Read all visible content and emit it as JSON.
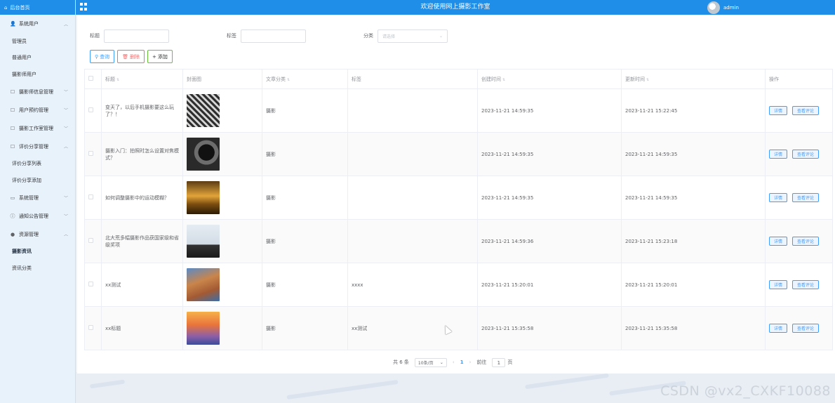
{
  "brand": {
    "label": "后台首页"
  },
  "header": {
    "title": "欢迎使用网上摄影工作室",
    "user": "admin"
  },
  "sidebar": {
    "groups": [
      {
        "label": "系统用户",
        "icon": "user-icon",
        "expanded": true,
        "items": [
          "管理员",
          "普通用户",
          "摄影师用户"
        ]
      },
      {
        "label": "摄影师信息管理",
        "icon": "doc-icon",
        "expanded": false,
        "items": []
      },
      {
        "label": "用户预约管理",
        "icon": "doc-icon",
        "expanded": false,
        "items": []
      },
      {
        "label": "摄影工作室管理",
        "icon": "doc-icon",
        "expanded": false,
        "items": []
      },
      {
        "label": "评价分享管理",
        "icon": "doc-icon",
        "expanded": true,
        "items": [
          "评价分享列表",
          "评价分享添加"
        ]
      },
      {
        "label": "系统管理",
        "icon": "monitor-icon",
        "expanded": false,
        "items": []
      },
      {
        "label": "通知公告管理",
        "icon": "info-icon",
        "expanded": false,
        "items": []
      },
      {
        "label": "资源管理",
        "icon": "shield-icon",
        "expanded": true,
        "items": [
          "摄影资讯",
          "资讯分类"
        ]
      }
    ],
    "active_item": "摄影资讯"
  },
  "filters": {
    "title_label": "标题",
    "tag_label": "标签",
    "category_label": "分类",
    "category_placeholder": "请选择"
  },
  "buttons": {
    "query": "查询",
    "delete": "删除",
    "add": "添加"
  },
  "table": {
    "headers": {
      "title": "标题",
      "cover": "封面图",
      "category": "文章分类",
      "tags": "标签",
      "created": "创建时间",
      "updated": "更新时间",
      "actions": "操作"
    },
    "rows": [
      {
        "title": "变天了，以后手机摄影要这么玩了？！",
        "category": "摄影",
        "tags": "",
        "created": "2023-11-21 14:59:35",
        "updated": "2023-11-21 15:22:45"
      },
      {
        "title": "摄影入门：拍照时怎么设置对焦模式？",
        "category": "摄影",
        "tags": "",
        "created": "2023-11-21 14:59:35",
        "updated": "2023-11-21 14:59:35"
      },
      {
        "title": "如何调整摄影中的运动模糊？",
        "category": "摄影",
        "tags": "",
        "created": "2023-11-21 14:59:35",
        "updated": "2023-11-21 14:59:35"
      },
      {
        "title": "北大荒多幅摄影作品获国家级和省级奖项",
        "category": "摄影",
        "tags": "",
        "created": "2023-11-21 14:59:36",
        "updated": "2023-11-21 15:23:18"
      },
      {
        "title": "xx测试",
        "category": "摄影",
        "tags": "xxxx",
        "created": "2023-11-21 15:20:01",
        "updated": "2023-11-21 15:20:01"
      },
      {
        "title": "xx标题",
        "category": "摄影",
        "tags": "xx测试",
        "created": "2023-11-21 15:35:58",
        "updated": "2023-11-21 15:35:58"
      }
    ],
    "row_actions": {
      "detail": "详情",
      "comments": "查看评论"
    }
  },
  "pagination": {
    "total": "共 6 条",
    "page_size": "10条/页",
    "current": "1",
    "goto_prefix": "前往",
    "goto_value": "1",
    "goto_suffix": "页"
  },
  "watermark": "CSDN @vx2_CXKF10088",
  "colors": {
    "primary": "#1f8ee9",
    "accent": "#409eff",
    "danger": "#f56c6c",
    "success": "#67c23a"
  }
}
